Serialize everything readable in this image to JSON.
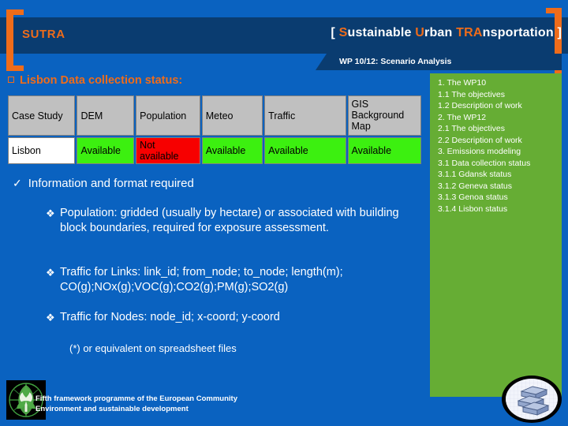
{
  "header": {
    "logo": "SUTRA",
    "title_full": "[ Sustainable Urban TRAnsportation ]",
    "title_parts": [
      {
        "text": "[ ",
        "accent": false
      },
      {
        "text": "S",
        "accent": true
      },
      {
        "text": "ustainable ",
        "accent": false
      },
      {
        "text": "U",
        "accent": true
      },
      {
        "text": "rban ",
        "accent": false
      },
      {
        "text": "TRA",
        "accent": true
      },
      {
        "text": "nsportation ]",
        "accent": false
      }
    ],
    "wp_banner": "WP 10/12: Scenario Analysis"
  },
  "section": {
    "heading": "Lisbon Data collection status:",
    "bullet_glyph": "square-outline"
  },
  "table": {
    "columns": [
      "Case Study",
      "DEM",
      "Population",
      "Meteo",
      "Traffic",
      "GIS Background Map"
    ],
    "rows": [
      {
        "case_study": "Lisbon",
        "cells": [
          {
            "value": "Lisbon",
            "state": "name"
          },
          {
            "value": "Available",
            "state": "available"
          },
          {
            "value": "Not available",
            "state": "missing"
          },
          {
            "value": "Available",
            "state": "available"
          },
          {
            "value": "Available",
            "state": "available"
          },
          {
            "value": "Available",
            "state": "available"
          }
        ]
      }
    ],
    "colors": {
      "header_bg": "#c0c0c0",
      "available": "#3cf010",
      "missing": "#f70000",
      "name_bg": "#ffffff"
    }
  },
  "content": {
    "lead_bullet": "Information and format required",
    "lead_glyph": "✓",
    "sub_glyph": "❖",
    "items": [
      {
        "text": "Population: gridded (usually by hectare) or associated with building block boundaries, required for exposure assessment."
      },
      {
        "text": "Traffic for Links: link_id; from_node; to_node; length(m); CO(g);NOx(g);VOC(g);CO2(g);PM(g);SO2(g)"
      },
      {
        "text": "Traffic for Nodes: node_id; x-coord; y-coord"
      }
    ],
    "note": "(*) or equivalent on spreadsheet files"
  },
  "outline": {
    "items": [
      "1. The WP10",
      "1.1 The objectives",
      "1.2 Description of work",
      "2. The WP12",
      "2.1 The objectives",
      "2.2 Description of work",
      "3. Emissions modeling",
      "3.1 Data collection status",
      "3.1.1 Gdansk status",
      "3.1.2 Geneva status",
      "3.1.3 Genoa status",
      "3.1.4 Lisbon status"
    ],
    "panel_color": "#66ad34"
  },
  "footer": {
    "line1": "Fifth framework programme of the European Community",
    "line2": "Environment and sustainable development"
  },
  "theme": {
    "background": "#0a62c0",
    "header_band": "#0a3c70",
    "accent_orange": "#ef6c1a",
    "text_white": "#ffffff"
  }
}
